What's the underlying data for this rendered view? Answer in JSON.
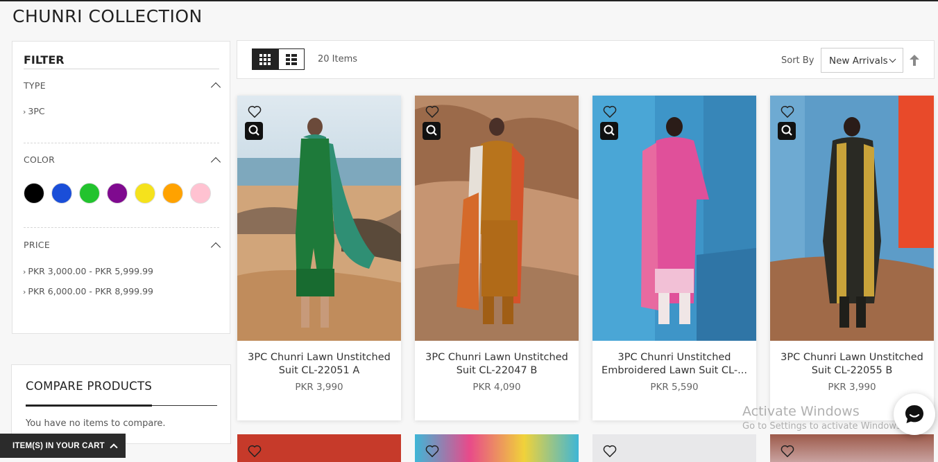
{
  "page": {
    "title": "CHUNRI COLLECTION"
  },
  "filter": {
    "title": "FILTER",
    "type": {
      "label": "TYPE",
      "options": [
        "3PC"
      ]
    },
    "color": {
      "label": "COLOR",
      "swatches": [
        {
          "name": "black",
          "hex": "#000000"
        },
        {
          "name": "blue",
          "hex": "#1a4ed8"
        },
        {
          "name": "green",
          "hex": "#22c32e"
        },
        {
          "name": "purple",
          "hex": "#7f0a8f"
        },
        {
          "name": "yellow",
          "hex": "#f5e21c"
        },
        {
          "name": "orange",
          "hex": "#ffa200"
        },
        {
          "name": "pink",
          "hex": "#ffc2d1"
        }
      ]
    },
    "price": {
      "label": "PRICE",
      "options": [
        "PKR 3,000.00 - PKR 5,999.99",
        "PKR 6,000.00 - PKR 8,999.99"
      ]
    }
  },
  "compare": {
    "title": "COMPARE PRODUCTS",
    "empty_text": "You have no items to compare."
  },
  "cart": {
    "label": "ITEM(S) IN YOUR CART"
  },
  "toolbar": {
    "items_count": "20 Items",
    "sort_by_label": "Sort By",
    "sort_value": "New Arrivals"
  },
  "products": [
    {
      "name_line1": "3PC Chunri Lawn Unstitched",
      "name_line2": "Suit CL-22051 A",
      "price": "PKR 3,990"
    },
    {
      "name_line1": "3PC Chunri Lawn Unstitched",
      "name_line2": "Suit CL-22047 B",
      "price": "PKR 4,090"
    },
    {
      "name_line1": "3PC Chunri Unstitched",
      "name_line2": "Embroidered Lawn Suit CL-...",
      "price": "PKR 5,590"
    },
    {
      "name_line1": "3PC Chunri Lawn Unstitched",
      "name_line2": "Suit CL-22055 B",
      "price": "PKR 3,990"
    }
  ],
  "watermark": {
    "line1": "Activate Windows",
    "line2": "Go to Settings to activate Windows."
  }
}
